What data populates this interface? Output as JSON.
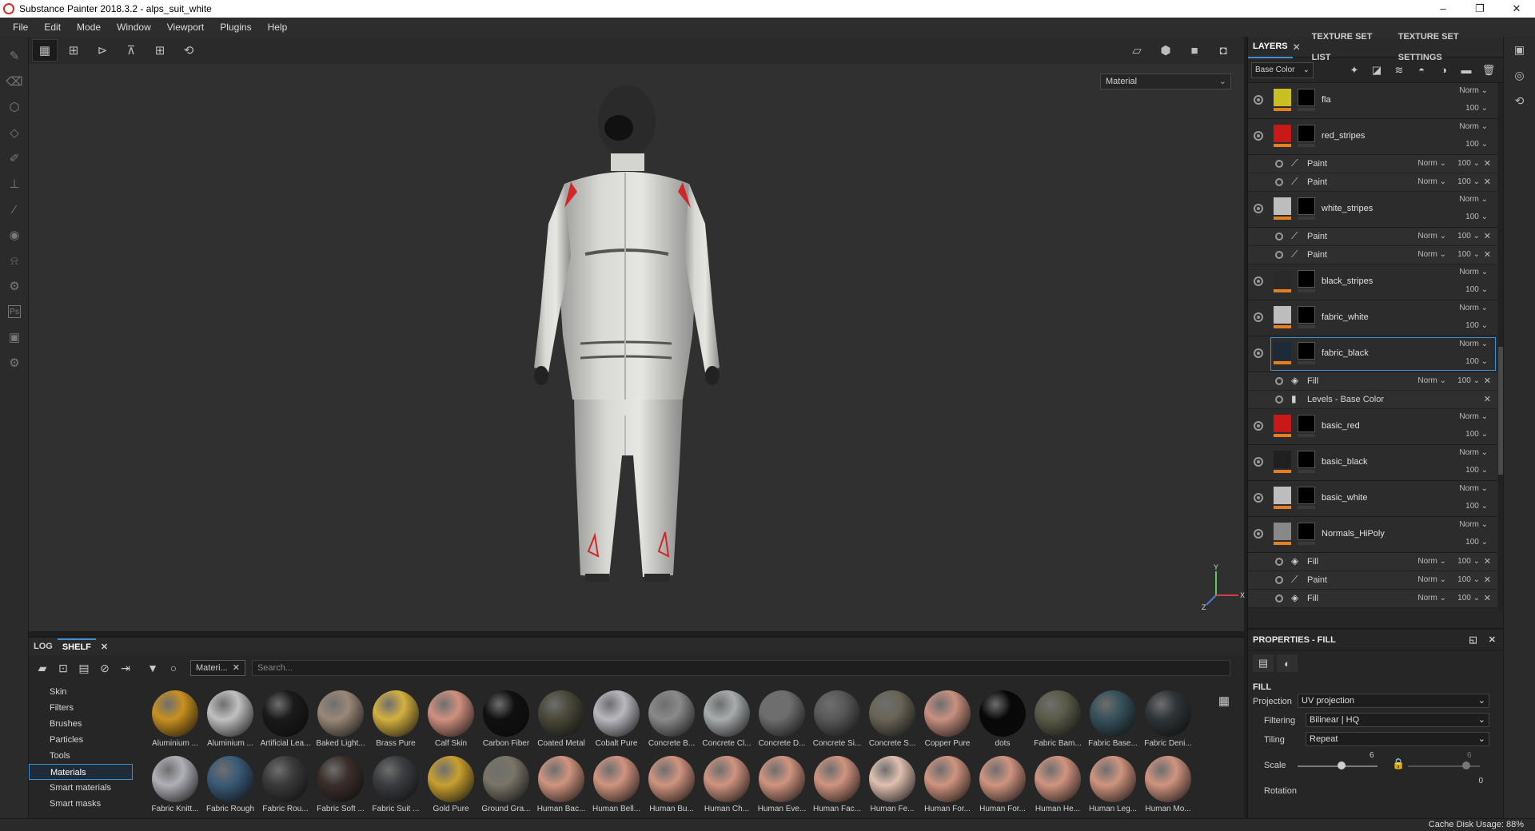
{
  "window": {
    "title": "Substance Painter 2018.3.2 - alps_suit_white",
    "controls": [
      "–",
      "❐",
      "✕"
    ]
  },
  "menu": [
    "File",
    "Edit",
    "Mode",
    "Window",
    "Viewport",
    "Plugins",
    "Help"
  ],
  "viewport": {
    "mode_select": "Material",
    "gizmo": {
      "x": "X",
      "y": "Y",
      "z": "Z"
    }
  },
  "right_panel": {
    "tabs": [
      "LAYERS",
      "TEXTURE SET LIST",
      "TEXTURE SET SETTINGS"
    ],
    "channel": "Base Color",
    "layers": [
      {
        "name": "fla",
        "blend": "Norm",
        "opacity": "100",
        "color": "#c8c020",
        "sublayers": []
      },
      {
        "name": "red_stripes",
        "blend": "Norm",
        "opacity": "100",
        "color": "#c81818",
        "sublayers": [
          {
            "type": "Paint",
            "blend": "Norm",
            "opacity": "100"
          },
          {
            "type": "Paint",
            "blend": "Norm",
            "opacity": "100"
          }
        ]
      },
      {
        "name": "white_stripes",
        "blend": "Norm",
        "opacity": "100",
        "color": "#bdbdbd",
        "sublayers": [
          {
            "type": "Paint",
            "blend": "Norm",
            "opacity": "100"
          },
          {
            "type": "Paint",
            "blend": "Norm",
            "opacity": "100"
          }
        ]
      },
      {
        "name": "black_stripes",
        "blend": "Norm",
        "opacity": "100",
        "color": "#2a2a2a",
        "sublayers": []
      },
      {
        "name": "fabric_white",
        "blend": "Norm",
        "opacity": "100",
        "color": "#bdbdbd",
        "sublayers": []
      },
      {
        "name": "fabric_black",
        "blend": "Norm",
        "opacity": "100",
        "color": "#1c2a3a",
        "selected": true,
        "sublayers": [
          {
            "type": "Fill",
            "blend": "Norm",
            "opacity": "100"
          },
          {
            "type": "Levels - Base Color",
            "blend": "",
            "opacity": ""
          }
        ]
      },
      {
        "name": "basic_red",
        "blend": "Norm",
        "opacity": "100",
        "color": "#c81818",
        "sublayers": []
      },
      {
        "name": "basic_black",
        "blend": "Norm",
        "opacity": "100",
        "color": "#202020",
        "sublayers": []
      },
      {
        "name": "basic_white",
        "blend": "Norm",
        "opacity": "100",
        "color": "#bdbdbd",
        "sublayers": []
      },
      {
        "name": "Normals_HiPoly",
        "blend": "Norm",
        "opacity": "100",
        "color": "#888888",
        "sublayers": [
          {
            "type": "Fill",
            "blend": "Norm",
            "opacity": "100"
          },
          {
            "type": "Paint",
            "blend": "Norm",
            "opacity": "100"
          },
          {
            "type": "Fill",
            "blend": "Norm",
            "opacity": "100"
          }
        ]
      }
    ]
  },
  "properties": {
    "title": "PROPERTIES - FILL",
    "section": "FILL",
    "projection_label": "Projection",
    "projection_value": "UV projection",
    "filtering_label": "Filtering",
    "filtering_value": "Bilinear | HQ",
    "tiling_label": "Tiling",
    "tiling_value": "Repeat",
    "scale_label": "Scale",
    "scale_value": "6",
    "scale_value_2": "6",
    "scale_value_fraction": 0.55,
    "rotation_label": "Rotation",
    "rotation_value": "0"
  },
  "shelf": {
    "tabs": [
      "LOG",
      "SHELF"
    ],
    "filter_chip": "Materi...",
    "search_placeholder": "Search...",
    "categories": [
      "Skin",
      "Filters",
      "Brushes",
      "Particles",
      "Tools",
      "Materials",
      "Smart materials",
      "Smart masks"
    ],
    "active_category": "Materials",
    "materials_row1": [
      {
        "name": "Aluminium ...",
        "color": "#c89020"
      },
      {
        "name": "Aluminium ...",
        "color": "#c0c0c0"
      },
      {
        "name": "Artificial Lea...",
        "color": "#1a1a1a"
      },
      {
        "name": "Baked Light...",
        "color": "#9a8878"
      },
      {
        "name": "Brass Pure",
        "color": "#d4b040"
      },
      {
        "name": "Calf Skin",
        "color": "#d09080"
      },
      {
        "name": "Carbon Fiber",
        "color": "#101010"
      },
      {
        "name": "Coated Metal",
        "color": "#4a4838"
      },
      {
        "name": "Cobalt Pure",
        "color": "#b8b8c0"
      },
      {
        "name": "Concrete B...",
        "color": "#8a8a8a"
      },
      {
        "name": "Concrete Cl...",
        "color": "#a8acae"
      },
      {
        "name": "Concrete D...",
        "color": "#6e6e6e"
      },
      {
        "name": "Concrete Si...",
        "color": "#585858"
      },
      {
        "name": "Concrete S...",
        "color": "#6a6458"
      },
      {
        "name": "Copper Pure",
        "color": "#c89080"
      },
      {
        "name": "dots",
        "color": "#080808"
      },
      {
        "name": "Fabric Bam...",
        "color": "#5a5a48"
      },
      {
        "name": "Fabric Base...",
        "color": "#36505a"
      },
      {
        "name": "Fabric Deni...",
        "color": "#2e3438"
      }
    ],
    "materials_row2": [
      {
        "name": "Fabric Knitt...",
        "color": "#b0b0b8"
      },
      {
        "name": "Fabric Rough",
        "color": "#3a5a78"
      },
      {
        "name": "Fabric Rou...",
        "color": "#3a3a3a"
      },
      {
        "name": "Fabric Soft ...",
        "color": "#3a2e2a"
      },
      {
        "name": "Fabric Suit ...",
        "color": "#3a3c40"
      },
      {
        "name": "Gold Pure",
        "color": "#c8a030"
      },
      {
        "name": "Ground Gra...",
        "color": "#7a7468"
      },
      {
        "name": "Human Bac...",
        "color": "#d09480"
      },
      {
        "name": "Human Bell...",
        "color": "#d09480"
      },
      {
        "name": "Human Bu...",
        "color": "#d09480"
      },
      {
        "name": "Human Ch...",
        "color": "#d09480"
      },
      {
        "name": "Human Eve...",
        "color": "#d09480"
      },
      {
        "name": "Human Fac...",
        "color": "#d09480"
      },
      {
        "name": "Human Fe...",
        "color": "#e0c0b0"
      },
      {
        "name": "Human For...",
        "color": "#d09480"
      },
      {
        "name": "Human For...",
        "color": "#d09480"
      },
      {
        "name": "Human He...",
        "color": "#d09480"
      },
      {
        "name": "Human Leg...",
        "color": "#d09480"
      },
      {
        "name": "Human Mo...",
        "color": "#d09480"
      }
    ]
  },
  "status": {
    "cache": "Cache Disk Usage:",
    "cache_value": "88%"
  }
}
